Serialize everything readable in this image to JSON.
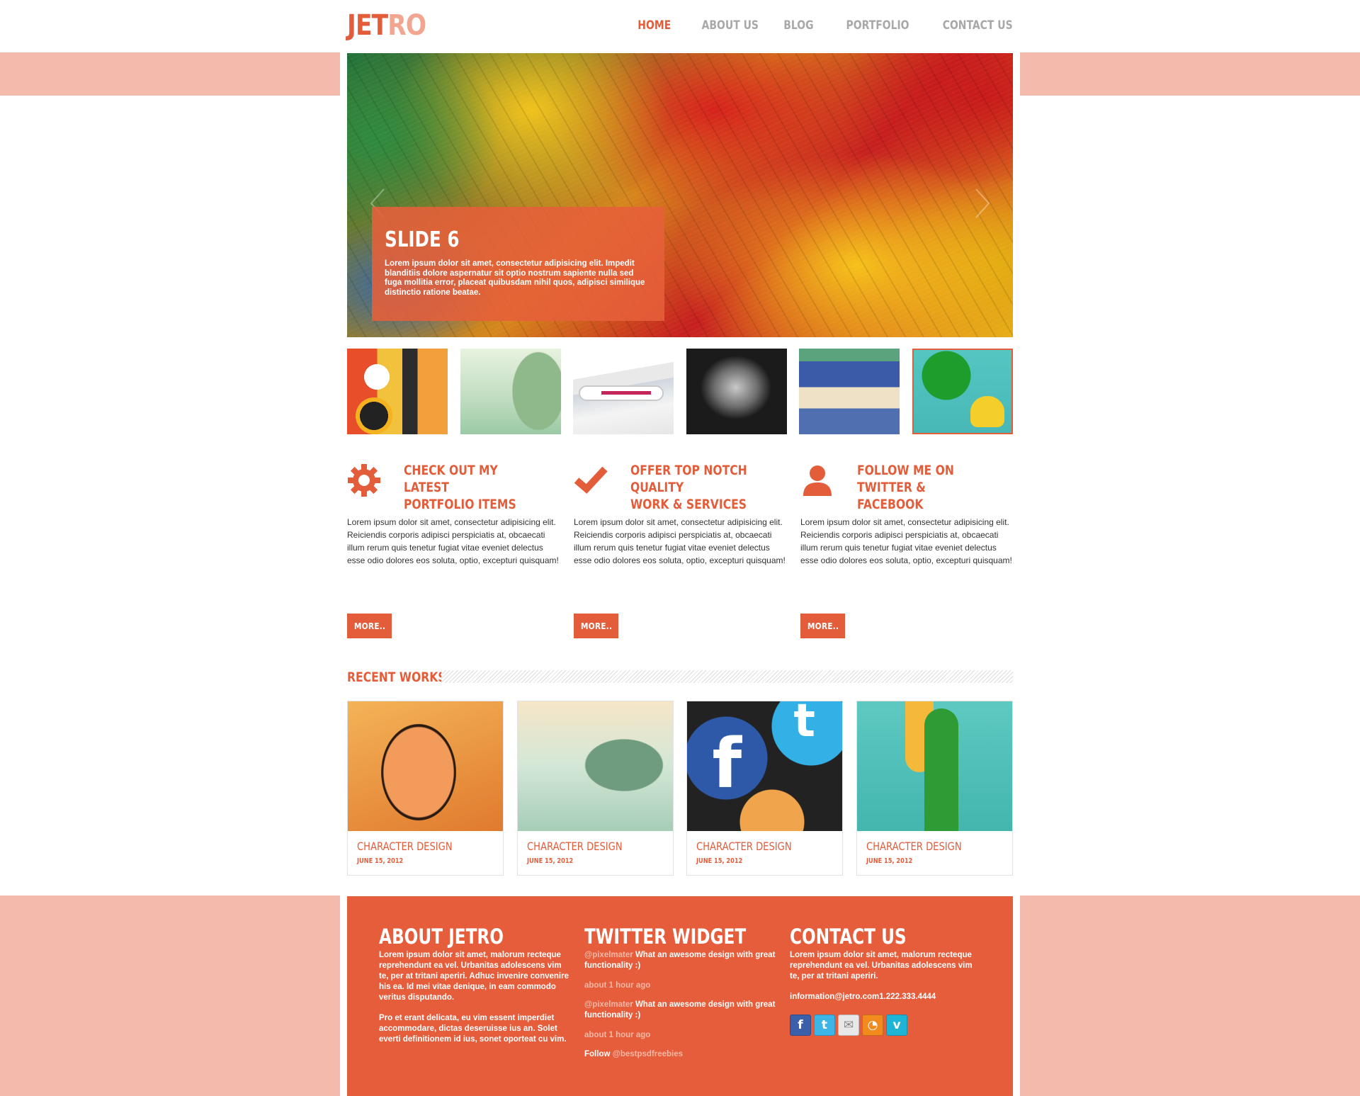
{
  "header": {
    "logo_part1": "JET",
    "logo_part2": "RO",
    "nav": [
      "HOME",
      "ABOUT US",
      "BLOG",
      "PORTFOLIO",
      "CONTACT US"
    ],
    "active_nav": "HOME"
  },
  "slider": {
    "caption_title": "SLIDE 6",
    "caption_text": "Lorem ipsum dolor sit amet, consectetur adipisicing elit. Impedit blanditiis dolore aspernatur sit optio nostrum sapiente nulla sed fuga mollitia error, placeat quibusdam nihil quos, adipisci similique distinctio ratione beatae.",
    "thumbnail_count": 6,
    "active_thumbnail": 6
  },
  "features": [
    {
      "icon": "gear-icon",
      "title": "CHECK OUT MY LATEST\nPORTFOLIO ITEMS",
      "text": "Lorem ipsum dolor sit amet, consectetur adipisicing elit. Reiciendis corporis adipisci perspiciatis at, obcaecati illum rerum quis tenetur fugiat vitae eveniet delectus esse odio dolores eos soluta, optio, excepturi quisquam!",
      "button": "MORE.."
    },
    {
      "icon": "checkmark-icon",
      "title": "OFFER TOP NOTCH QUALITY\nWORK & SERVICES",
      "text": "Lorem ipsum dolor sit amet, consectetur adipisicing elit. Reiciendis corporis adipisci perspiciatis at, obcaecati illum rerum quis tenetur fugiat vitae eveniet delectus esse odio dolores eos soluta, optio, excepturi quisquam!",
      "button": "MORE.."
    },
    {
      "icon": "user-icon",
      "title": "FOLLOW ME ON TWITTER &\nFACEBOOK",
      "text": "Lorem ipsum dolor sit amet, consectetur adipisicing elit. Reiciendis corporis adipisci perspiciatis at, obcaecati illum rerum quis tenetur fugiat vitae eveniet delectus esse odio dolores eos soluta, optio, excepturi quisquam!",
      "button": "MORE.."
    }
  ],
  "recent_works": {
    "title": "RECENT WORKS",
    "items": [
      {
        "title": "CHARACTER DESIGN",
        "date": "JUNE 15, 2012"
      },
      {
        "title": "CHARACTER DESIGN",
        "date": "JUNE 15, 2012"
      },
      {
        "title": "CHARACTER DESIGN",
        "date": "JUNE 15, 2012"
      },
      {
        "title": "CHARACTER DESIGN",
        "date": "JUNE 15, 2012"
      }
    ]
  },
  "footer": {
    "about": {
      "title": "ABOUT JETRO",
      "p1": "Lorem ipsum dolor sit amet, malorum recteque reprehendunt ea vel. Urbanitas adolescens vim te, per at tritani aperiri. Adhuc invenire convenire his ea. Id mei vitae denique, in eam commodo veritus disputando.",
      "p2": "Pro et erant delicata, eu vim essent imperdiet accommodare, dictas deseruisse ius an. Solet everti definitionem id ius, sonet oporteat cu vim."
    },
    "twitter": {
      "title": "TWITTER WIDGET",
      "tweets": [
        {
          "handle": "@pixelmater",
          "text": " What an awesome design with great functionality :)",
          "time": "about 1 hour ago"
        },
        {
          "handle": "@pixelmater",
          "text": " What an awesome design with great functionality :)",
          "time": "about 1 hour ago"
        }
      ],
      "follow_label": "Follow ",
      "follow_handle": "@bestpsdfreebies"
    },
    "contact": {
      "title": "CONTACT US",
      "text": "Lorem ipsum dolor sit amet, malorum recteque reprehendunt ea vel. Urbanitas adolescens vim te, per at tritani aperiri.",
      "email_phone": "information@jetro.com1.222.333.4444",
      "social": [
        "facebook-icon",
        "twitter-icon",
        "email-icon",
        "rss-icon",
        "vimeo-icon"
      ]
    }
  },
  "colors": {
    "accent": "#e35d3b",
    "light_accent": "#f2a68f",
    "band": "#f4bbac",
    "footer_bg": "#e65d3b"
  }
}
